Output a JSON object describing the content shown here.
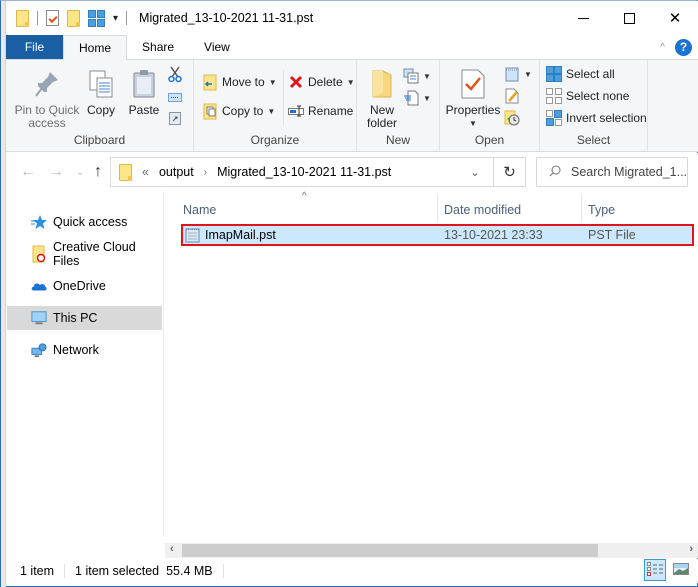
{
  "window": {
    "title": "Migrated_13-10-2021 11-31.pst",
    "controls": {
      "minimize": "minimize",
      "maximize": "maximize",
      "close": "✕"
    }
  },
  "quick_access_toolbar": {
    "icons": [
      "folder-icon",
      "properties-icon",
      "new-folder-icon",
      "view-grid-icon"
    ],
    "customize": "▾"
  },
  "ribbon": {
    "tabs": [
      {
        "label": "File",
        "active": false
      },
      {
        "label": "Home",
        "active": true
      },
      {
        "label": "Share",
        "active": false
      },
      {
        "label": "View",
        "active": false
      }
    ],
    "collapse_caret": "^",
    "help": "?",
    "groups": {
      "clipboard": {
        "label": "Clipboard",
        "pin_label_1": "Pin to Quick",
        "pin_label_2": "access",
        "copy": "Copy",
        "paste": "Paste"
      },
      "organize": {
        "label": "Organize",
        "move_to": "Move to",
        "copy_to": "Copy to",
        "delete": "Delete",
        "rename": "Rename"
      },
      "new": {
        "label": "New",
        "new_folder_1": "New",
        "new_folder_2": "folder"
      },
      "open": {
        "label": "Open",
        "properties": "Properties"
      },
      "select": {
        "label": "Select",
        "select_all": "Select all",
        "select_none": "Select none",
        "invert_selection": "Invert selection"
      }
    }
  },
  "address_bar": {
    "overflow": "«",
    "crumbs": [
      "output",
      "Migrated_13-10-2021 11-31.pst"
    ],
    "separator": "›",
    "search_placeholder": "Search Migrated_1..."
  },
  "nav_pane": {
    "items": [
      {
        "label": "Quick access",
        "icon": "star-icon",
        "selected": false
      },
      {
        "label": "Creative Cloud Files",
        "icon": "creative-cloud-folder-icon",
        "selected": false
      },
      {
        "label": "OneDrive",
        "icon": "cloud-icon",
        "selected": false
      },
      {
        "label": "This PC",
        "icon": "monitor-icon",
        "selected": true
      },
      {
        "label": "Network",
        "icon": "network-icon",
        "selected": false
      }
    ]
  },
  "file_list": {
    "columns": [
      "Name",
      "Date modified",
      "Type"
    ],
    "sort_indicator": "^",
    "rows": [
      {
        "name": "ImapMail.pst",
        "date_modified": "13-10-2021 23:33",
        "type": "PST File",
        "selected": true
      }
    ]
  },
  "status_bar": {
    "item_count": "1 item",
    "selection": "1 item selected",
    "size": "55.4 MB"
  },
  "colors": {
    "file_tab": "#1a5ea6",
    "selection": "#cce8ff",
    "highlight_border": "#e0141d"
  }
}
